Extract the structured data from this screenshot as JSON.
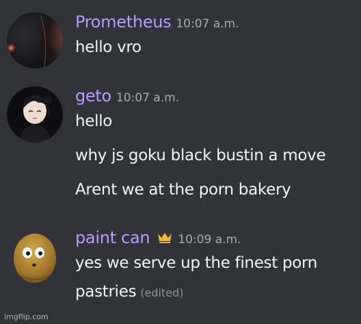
{
  "messages": [
    {
      "author": "Prometheus",
      "time": "10:07 a.m.",
      "avatar": "planet-avatar",
      "lines": [
        "hello vro"
      ]
    },
    {
      "author": "geto",
      "time": "10:07 a.m.",
      "avatar": "anime-character-avatar",
      "lines": [
        "hello",
        "why js goku black bustin a move",
        "Arent we at the porn bakery"
      ]
    },
    {
      "author": "paint can",
      "time": "10:09 a.m.",
      "avatar": "wall-nut-avatar",
      "badge": "crown-icon",
      "lines": [
        "yes we serve up the finest porn",
        "pastries"
      ],
      "edited_label": "(edited)"
    }
  ],
  "watermark": "imgflip.com",
  "colors": {
    "background": "#313338",
    "username": "#b79cff",
    "timestamp": "#a9abb3",
    "text": "#f2f3f5",
    "crown": "#f0b232"
  }
}
